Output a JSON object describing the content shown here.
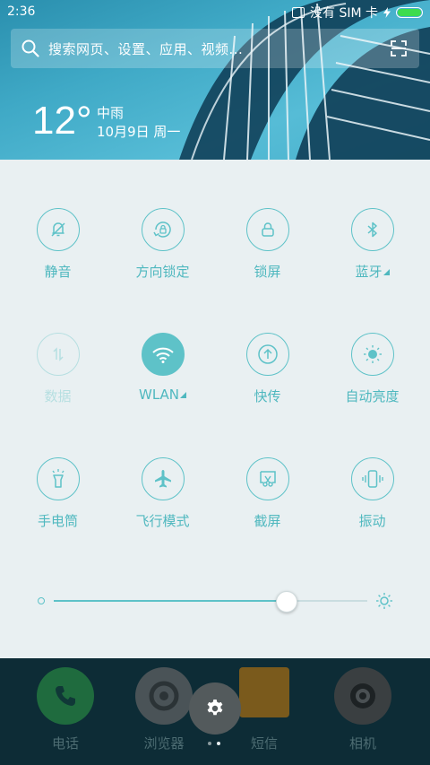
{
  "status_bar": {
    "time": "2:36",
    "sim_text": "没有 SIM 卡",
    "battery_level": 1.0
  },
  "search": {
    "placeholder": "搜索网页、设置、应用、视频..."
  },
  "weather": {
    "temperature": "12°",
    "condition": "中雨",
    "date": "10月9日 周一"
  },
  "toggles": [
    {
      "label": "静音",
      "icon": "bell-icon",
      "state": "off"
    },
    {
      "label": "方向锁定",
      "icon": "rotation-lock-icon",
      "state": "off"
    },
    {
      "label": "锁屏",
      "icon": "lock-icon",
      "state": "off"
    },
    {
      "label": "蓝牙",
      "icon": "bluetooth-icon",
      "state": "off",
      "has_more": true
    },
    {
      "label": "数据",
      "icon": "data-arrows-icon",
      "state": "disabled"
    },
    {
      "label": "WLAN",
      "icon": "wifi-icon",
      "state": "on",
      "has_more": true
    },
    {
      "label": "快传",
      "icon": "upload-icon",
      "state": "off"
    },
    {
      "label": "自动亮度",
      "icon": "auto-brightness-icon",
      "state": "off"
    },
    {
      "label": "手电筒",
      "icon": "flashlight-icon",
      "state": "off"
    },
    {
      "label": "飞行模式",
      "icon": "airplane-icon",
      "state": "off"
    },
    {
      "label": "截屏",
      "icon": "screenshot-icon",
      "state": "off"
    },
    {
      "label": "振动",
      "icon": "vibrate-icon",
      "state": "off"
    }
  ],
  "brightness": {
    "level": 0.74
  },
  "dock": [
    {
      "label": "电话",
      "icon": "phone-icon",
      "color": "#1f6b3e"
    },
    {
      "label": "浏览器",
      "icon": "browser-icon",
      "color": "#4a5357"
    },
    {
      "label": "短信",
      "icon": "message-icon",
      "color": "#7a5a1c"
    },
    {
      "label": "相机",
      "icon": "camera-icon",
      "color": "#3a3f41"
    }
  ],
  "colors": {
    "accent": "#5ec2c8",
    "panel": "#e9f0f2",
    "dock": "#0d2c36"
  }
}
